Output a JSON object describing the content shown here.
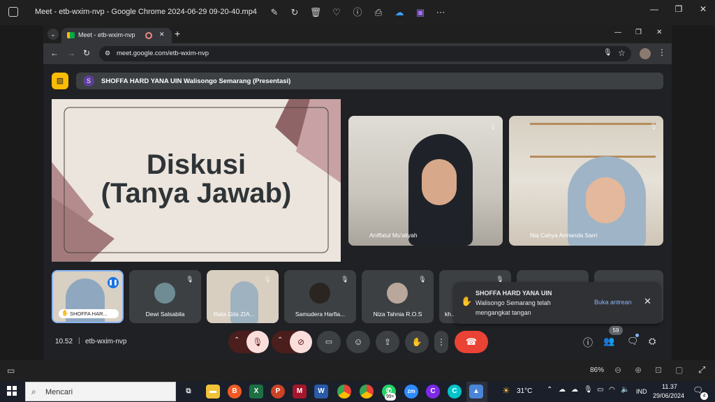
{
  "photos": {
    "title": "Meet - etb-wxim-nvp - Google Chrome 2024-06-29 09-20-40.mp4",
    "zoom": "86%"
  },
  "chrome": {
    "tab_title": "Meet - etb-wxim-nvp",
    "url": "meet.google.com/etb-wxim-nvp"
  },
  "meet": {
    "presenter_initial": "S",
    "presenter_label": "SHOFFA HARD YANA UIN Walisongo Semarang (Presentasi)",
    "slide": {
      "line1": "Diskusi",
      "line2": "(Tanya Jawab)"
    },
    "main_tiles": [
      {
        "name": "Aniffatul Mu'aliyah"
      },
      {
        "name": "Nia Cahya Armanda Sarri"
      }
    ],
    "strip": [
      {
        "name": "SHOFFA HAR..."
      },
      {
        "name": "Dewi Salsabila"
      },
      {
        "name": "Rata Gita ZIA..."
      },
      {
        "name": "Samudera Harfia..."
      },
      {
        "name": "Niza Tahnia R.O.S"
      },
      {
        "name": "kh..."
      }
    ],
    "toast": {
      "line1": "SHOFFA HARD YANA UIN",
      "line2": "Walisongo Semarang telah",
      "line3": "mengangkat tangan",
      "action": "Buka antrean"
    },
    "time": "10.52",
    "code": "etb-wxim-nvp",
    "participants_badge": "59"
  },
  "taskbar": {
    "search_placeholder": "Mencari",
    "weather": "31°C",
    "lang": "IND",
    "time": "11.37",
    "date": "29/06/2024",
    "whatsapp_badge": "99+",
    "notif_count": "4"
  },
  "colors": {
    "end_call": "#ea4335",
    "mic_off_bg": "#f9dedc",
    "accent": "#8ab4f8",
    "presenter_badge": "#fbbc04"
  }
}
